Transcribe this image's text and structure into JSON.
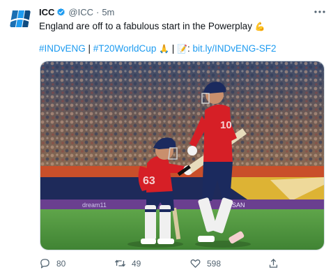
{
  "author": {
    "name": "ICC",
    "handle": "@ICC",
    "separator": "·",
    "time": "5m"
  },
  "tweet": {
    "text": "England are off to a fabulous start in the Powerplay",
    "text_emoji": "💪",
    "hashtag1": "#INDvENG",
    "sep1": " | ",
    "hashtag2": "#T20WorldCup",
    "pray_emoji": "🙏",
    "sep2": " | ",
    "memo_emoji": "📝",
    "colon": ": ",
    "link": "bit.ly/INDvENG-SF2"
  },
  "media": {
    "alt": "Two England batters in red kits bump gloves at the crease during a T20 World Cup match",
    "jersey_left": "63",
    "jersey_right": "10",
    "board_text_1": "dream11",
    "board_text_2": "NISSAN"
  },
  "actions": {
    "reply_count": "80",
    "retweet_count": "49",
    "like_count": "598"
  },
  "icons": {
    "avatar": "icc-logo-icon",
    "verified": "verified-badge-icon",
    "more": "more-icon",
    "reply": "reply-icon",
    "retweet": "retweet-icon",
    "like": "heart-icon",
    "share": "share-icon"
  },
  "colors": {
    "link": "#1d9bf0",
    "verified": "#1d9bf0",
    "secondary_text": "#536471",
    "jersey": "#d61f26",
    "trousers": "#1b2a5e"
  }
}
